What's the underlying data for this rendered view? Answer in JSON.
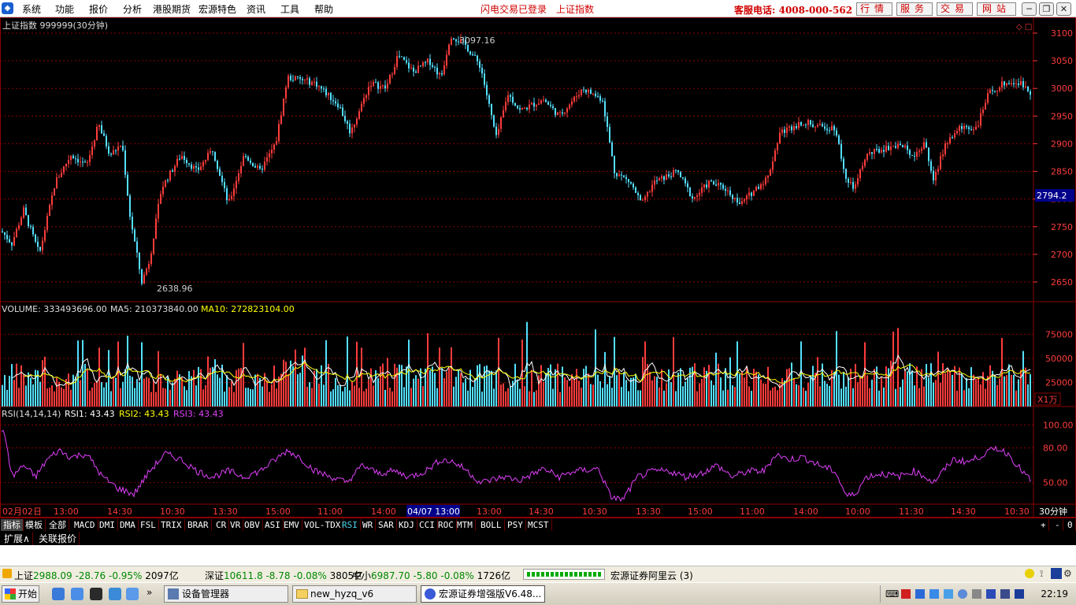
{
  "menubar": {
    "items": [
      "系统",
      "功能",
      "报价",
      "分析",
      "港股期货",
      "宏源特色",
      "资讯",
      "工具",
      "帮助"
    ],
    "flash_status": "闪电交易已登录",
    "index_label": "上证指数",
    "hotline": "客服电话: 4008-000-562",
    "buttons": [
      "行情",
      "服务",
      "交易",
      "网站"
    ]
  },
  "chart": {
    "title": "上证指数 999999(30分钟)",
    "price_axis": [
      "3100",
      "3050",
      "3000",
      "2950",
      "2900",
      "2850",
      "2800",
      "2750",
      "2700",
      "2650"
    ],
    "current_price": "2794.2",
    "high_label": "3097.16",
    "low_label": "2638.96",
    "volume_title": "VOLUME: 333493696.00",
    "ma5_label": "MA5: 210373840.00",
    "ma10_label": "MA10: 272823104.00",
    "volume_axis": [
      "75000",
      "50000",
      "25000"
    ],
    "volume_unit": "X1万",
    "rsi_params": "RSI(14,14,14)",
    "rsi1_label": "RSI1: 43.43",
    "rsi2_label": "RSI2: 43.43",
    "rsi3_label": "RSI3: 43.43",
    "rsi_axis": [
      "100.00",
      "80.00",
      "50.00"
    ],
    "time_labels": [
      "02月02日",
      "13:00",
      "14:30",
      "10:30",
      "13:30",
      "15:00",
      "11:00",
      "14:00",
      "04/07 13:00",
      "13:00",
      "14:30",
      "10:30",
      "13:30",
      "15:00",
      "11:00",
      "14:00",
      "10:00",
      "11:30",
      "14:30",
      "10:30"
    ],
    "period": "30分钟",
    "colors": {
      "up": "#ff3c3c",
      "down": "#54e0ff",
      "ma5": "#ffffff",
      "ma10": "#ffff00",
      "rsi": "#e040fb",
      "grid": "#8b0000"
    }
  },
  "indicator_tabs": [
    "指标",
    "模板",
    "全部",
    "MACD",
    "DMI",
    "DMA",
    "FSL",
    "TRIX",
    "BRAR",
    "CR",
    "VR",
    "OBV",
    "ASI",
    "EMV",
    "VOL-TDX",
    "RSI",
    "WR",
    "SAR",
    "KDJ",
    "CCI",
    "ROC",
    "MTM",
    "BOLL",
    "PSY",
    "MCST"
  ],
  "zoom_controls": [
    "+",
    "-",
    "0"
  ],
  "sub_tabs": [
    "扩展∧",
    "关联报价"
  ],
  "status": {
    "sh_label": "上证",
    "sh_price": "2988.09",
    "sh_change": "-28.76",
    "sh_pct": "-0.95%",
    "sh_amount": "2097亿",
    "sz_label": "深证",
    "sz_price": "10611.8",
    "sz_change": "-8.78",
    "sz_pct": "-0.08%",
    "sz_amount": "3805亿",
    "zx_label": "中小",
    "zx_price": "6987.70",
    "zx_change": "-5.80",
    "zx_pct": "-0.08%",
    "zx_amount": "1726亿",
    "server": "宏源证券阿里云 (3)"
  },
  "taskbar": {
    "start": "开始",
    "tasks": [
      "设备管理器",
      "new_hyzq_v6",
      "宏源证券增强版V6.48..."
    ],
    "time": "22:19"
  }
}
